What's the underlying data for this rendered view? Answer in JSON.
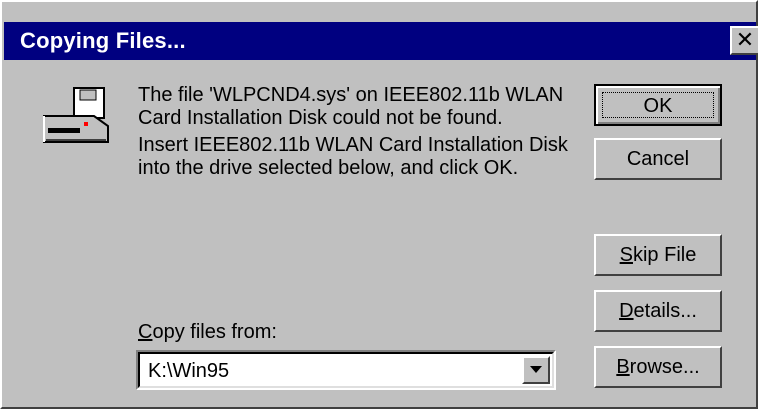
{
  "window": {
    "title": "Copying Files...",
    "close_glyph": "✕"
  },
  "icon": "floppy-drive-icon",
  "message": {
    "line1": "The file 'WLPCND4.sys' on IEEE802.11b WLAN Card Installation Disk could not be found.",
    "line2": "Insert IEEE802.11b WLAN Card Installation Disk into the drive selected below, and click OK."
  },
  "copy_from": {
    "label_accel": "C",
    "label_rest": "opy files from:",
    "value": "K:\\Win95"
  },
  "buttons": {
    "ok": "OK",
    "cancel": "Cancel",
    "skip_accel": "S",
    "skip_rest": "kip File",
    "details_accel": "D",
    "details_rest": "etails...",
    "browse_accel": "B",
    "browse_rest": "rowse..."
  },
  "colors": {
    "titlebar": "#000080",
    "face": "#c0c0c0"
  }
}
